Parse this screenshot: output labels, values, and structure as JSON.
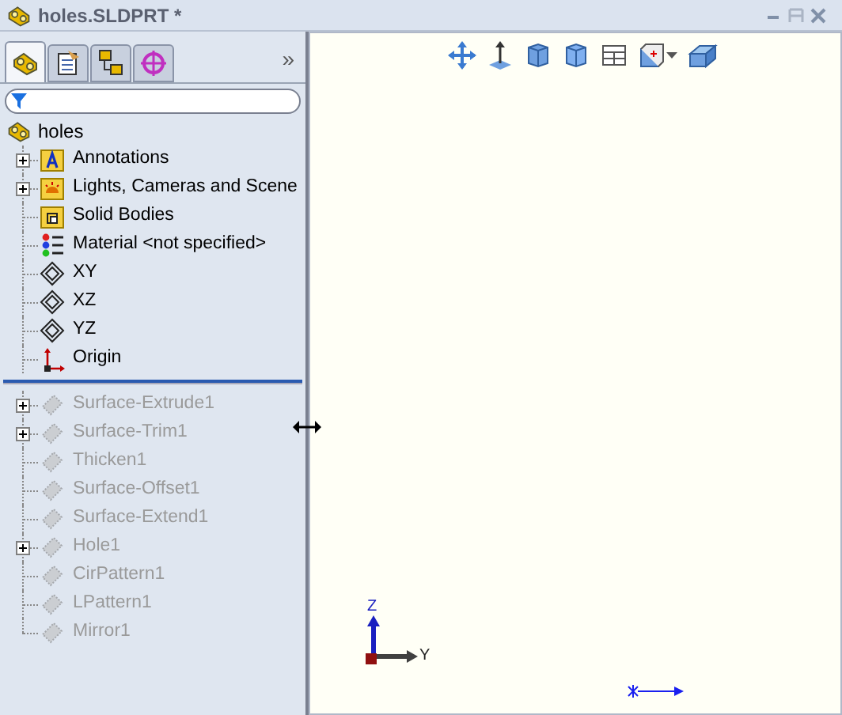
{
  "window": {
    "title": "holes.SLDPRT *"
  },
  "tabs": [
    {
      "kind": "part",
      "selected": true
    },
    {
      "kind": "property",
      "selected": false
    },
    {
      "kind": "config",
      "selected": false
    },
    {
      "kind": "target",
      "selected": false
    }
  ],
  "more_tabs": "»",
  "tree": {
    "root": "holes",
    "items": [
      {
        "label": "Annotations",
        "kind": "annotations",
        "expandable": true,
        "dimmed": false
      },
      {
        "label": "Lights, Cameras and Scene",
        "kind": "lights",
        "expandable": true,
        "dimmed": false
      },
      {
        "label": "Solid Bodies",
        "kind": "bodies",
        "expandable": false,
        "dimmed": false
      },
      {
        "label": "Material <not specified>",
        "kind": "material",
        "expandable": false,
        "dimmed": false
      },
      {
        "label": "XY",
        "kind": "plane",
        "expandable": false,
        "dimmed": false
      },
      {
        "label": "XZ",
        "kind": "plane",
        "expandable": false,
        "dimmed": false
      },
      {
        "label": "YZ",
        "kind": "plane",
        "expandable": false,
        "dimmed": false
      },
      {
        "label": "Origin",
        "kind": "origin",
        "expandable": false,
        "dimmed": false
      }
    ],
    "rolled_back": [
      {
        "label": "Surface-Extrude1",
        "kind": "feature",
        "expandable": true,
        "dimmed": true
      },
      {
        "label": "Surface-Trim1",
        "kind": "feature",
        "expandable": true,
        "dimmed": true
      },
      {
        "label": "Thicken1",
        "kind": "feature",
        "expandable": false,
        "dimmed": true
      },
      {
        "label": "Surface-Offset1",
        "kind": "feature",
        "expandable": false,
        "dimmed": true
      },
      {
        "label": "Surface-Extend1",
        "kind": "feature",
        "expandable": false,
        "dimmed": true
      },
      {
        "label": "Hole1",
        "kind": "feature",
        "expandable": true,
        "dimmed": true
      },
      {
        "label": "CirPattern1",
        "kind": "feature",
        "expandable": false,
        "dimmed": true
      },
      {
        "label": "LPattern1",
        "kind": "feature",
        "expandable": false,
        "dimmed": true
      },
      {
        "label": "Mirror1",
        "kind": "feature",
        "expandable": false,
        "dimmed": true
      }
    ]
  },
  "triad": {
    "z": "Z",
    "y": "Y"
  }
}
